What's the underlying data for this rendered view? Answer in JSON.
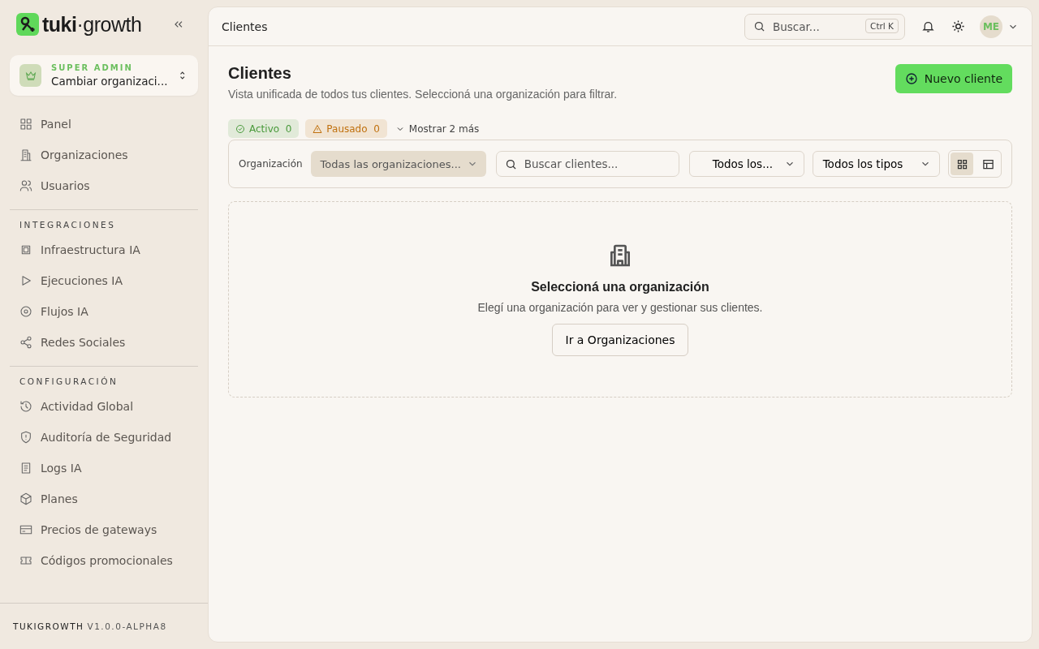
{
  "sidebar": {
    "logo": "**tuki**·growth",
    "org_switcher": {
      "role": "SUPER ADMIN",
      "label": "Cambiar organizaci..."
    },
    "sections": [
      {
        "items": [
          {
            "label": "Panel",
            "selected": false
          },
          {
            "label": "Organizaciones",
            "selected": false
          },
          {
            "label": "Usuarios",
            "selected": false
          }
        ]
      },
      {
        "heading": "INTEGRACIONES",
        "items": [
          {
            "label": "Infraestructura IA",
            "selected": false
          },
          {
            "label": "Ejecuciones IA",
            "selected": false
          },
          {
            "label": "Flujos IA",
            "selected": false
          },
          {
            "label": "Redes Sociales",
            "selected": false
          }
        ]
      },
      {
        "heading": "CONFIGURACIÓN",
        "items": [
          {
            "label": "Actividad Global",
            "selected": false
          },
          {
            "label": "Auditoría de Seguridad",
            "selected": false
          },
          {
            "label": "Logs IA",
            "selected": false
          },
          {
            "label": "Planes",
            "selected": false
          },
          {
            "label": "Precios de gateways",
            "selected": false
          },
          {
            "label": "Códigos promocionales",
            "selected": false
          }
        ]
      }
    ],
    "footer": {
      "brand": "TUKIGROWTH",
      "version": "V1.0.0-ALPHA8"
    }
  },
  "topbar": {
    "title": "Clientes",
    "search": {
      "placeholder": "Buscar...",
      "shortcut": "Ctrl K"
    },
    "avatar": "ME"
  },
  "page": {
    "title": "Clientes",
    "subtitle": "Vista unificada de todos tus clientes. Seleccioná una organización para filtrar.",
    "primary_button": "Nuevo cliente",
    "status_chips": [
      {
        "label": "Activo",
        "count": "0",
        "kind": "ok",
        "color": "#4a9a3c"
      },
      {
        "label": "Pausado",
        "count": "0",
        "kind": "warn",
        "color": "#c0710f"
      }
    ],
    "show_more": "Mostrar 2 más",
    "filters": {
      "org_label": "Organización",
      "org_select": "Todas las organizaciones...",
      "search_placeholder": "Buscar clientes...",
      "status_select": "Todos los...",
      "type_select": "Todos los tipos",
      "views": [
        {
          "kind": "grid",
          "selected": true
        },
        {
          "kind": "table",
          "selected": false
        }
      ]
    },
    "empty_state": {
      "title": "Seleccioná una organización",
      "message": "Elegí una organización para ver y gestionar sus clientes.",
      "button": "Ir a Organizaciones"
    }
  }
}
